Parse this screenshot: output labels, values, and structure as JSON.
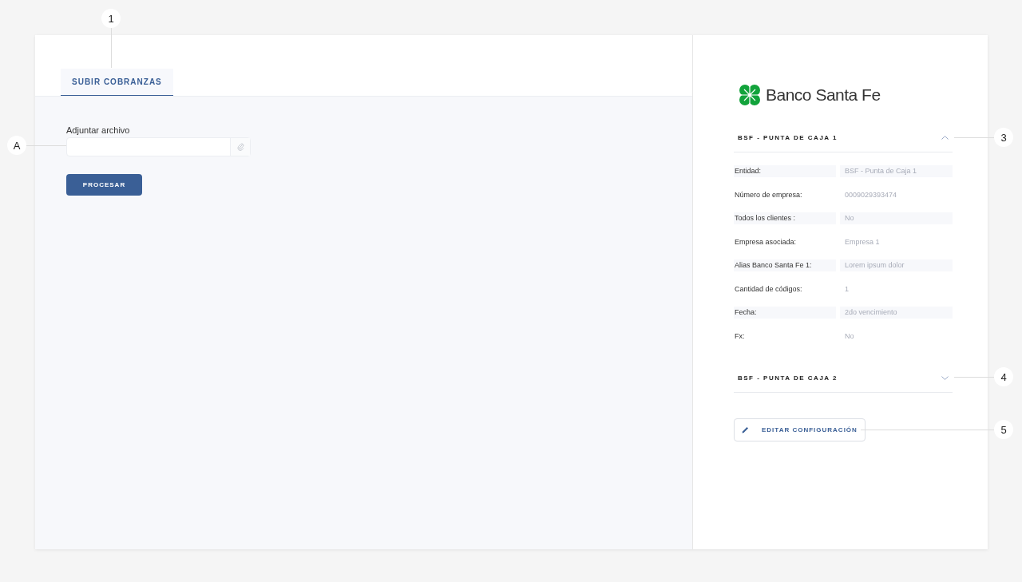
{
  "tabs": [
    {
      "label": "SUBIR COBRANZAS",
      "selected": true
    }
  ],
  "upload": {
    "label": "Adjuntar archivo",
    "button": "PROCESAR"
  },
  "bank": {
    "name": "Banco Santa Fe"
  },
  "sections": [
    {
      "title": "BSF - PUNTA DE CAJA 1",
      "expanded": true,
      "rows": [
        {
          "label": "Entidad:",
          "value": "BSF - Punta de Caja 1",
          "shaded": true
        },
        {
          "label": "Número de empresa:",
          "value": "0009029393474",
          "shaded": false
        },
        {
          "label": "Todos los clientes :",
          "value": "No",
          "shaded": true
        },
        {
          "label": "Empresa asociada:",
          "value": "Empresa 1",
          "shaded": false
        },
        {
          "label": "Alias Banco Santa Fe 1:",
          "value": "Lorem ipsum dolor",
          "shaded": true
        },
        {
          "label": "Cantidad de códigos:",
          "value": "1",
          "shaded": false
        },
        {
          "label": "Fecha:",
          "value": "2do vencimiento",
          "shaded": true
        },
        {
          "label": "Fx:",
          "value": "No",
          "shaded": false
        }
      ]
    },
    {
      "title": "BSF - PUNTA DE CAJA 2",
      "expanded": false
    }
  ],
  "edit_button": "EDITAR CONFIGURACIÓN",
  "annotations": [
    "1",
    "A",
    "3",
    "4",
    "5"
  ]
}
